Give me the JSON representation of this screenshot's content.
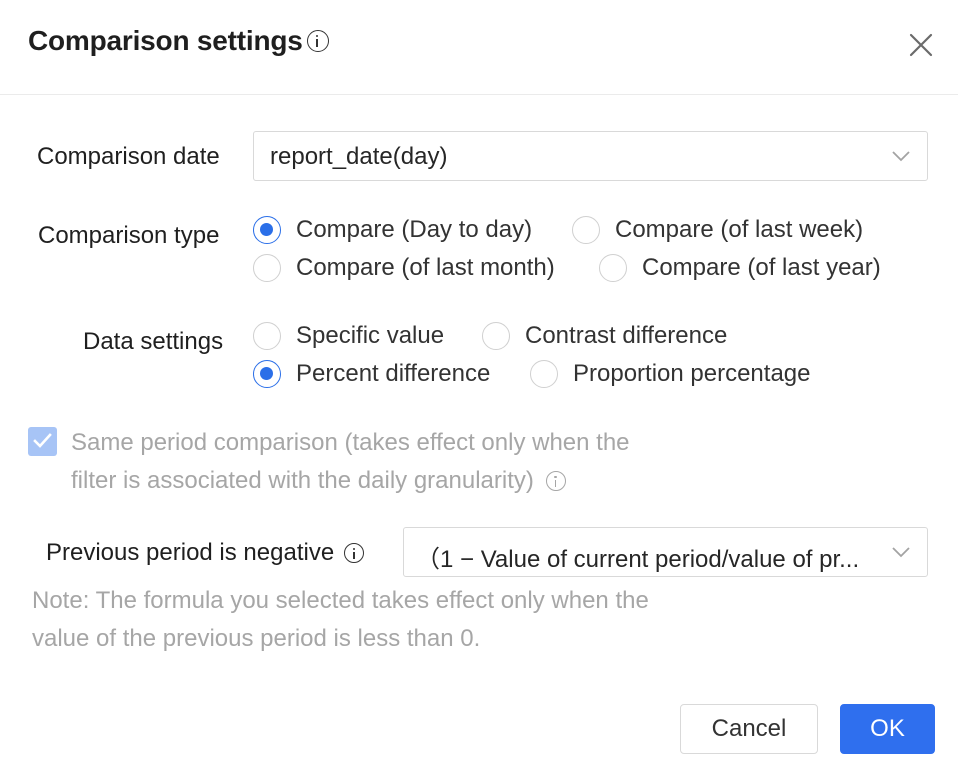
{
  "dialog": {
    "title": "Comparison settings",
    "comparison_date": {
      "label": "Comparison date",
      "value": "report_date(day)"
    },
    "comparison_type": {
      "label": "Comparison type",
      "options": [
        {
          "label": "Compare (Day to day)",
          "checked": true
        },
        {
          "label": "Compare (of last week)",
          "checked": false
        },
        {
          "label": "Compare (of last month)",
          "checked": false
        },
        {
          "label": "Compare (of last year)",
          "checked": false
        }
      ]
    },
    "data_settings": {
      "label": "Data settings",
      "options": [
        {
          "label": "Specific value",
          "checked": false
        },
        {
          "label": "Contrast difference",
          "checked": false
        },
        {
          "label": "Percent difference",
          "checked": true
        },
        {
          "label": "Proportion percentage",
          "checked": false
        }
      ]
    },
    "same_period": {
      "checked": true,
      "disabled": true,
      "line1": "Same period comparison (takes effect only when the",
      "line2": "filter is associated with the daily granularity)"
    },
    "previous_negative": {
      "label": "Previous period is negative",
      "value": "（1 − Value of current period/value of pr..."
    },
    "note": {
      "line1": "Note: The formula you selected takes effect only when the",
      "line2": "value of the previous period is less than 0."
    },
    "buttons": {
      "cancel": "Cancel",
      "ok": "OK"
    },
    "colors": {
      "accent": "#2f6fee",
      "checkbox_disabled": "#a7c4f6",
      "muted_text": "#a6a6a6"
    }
  }
}
